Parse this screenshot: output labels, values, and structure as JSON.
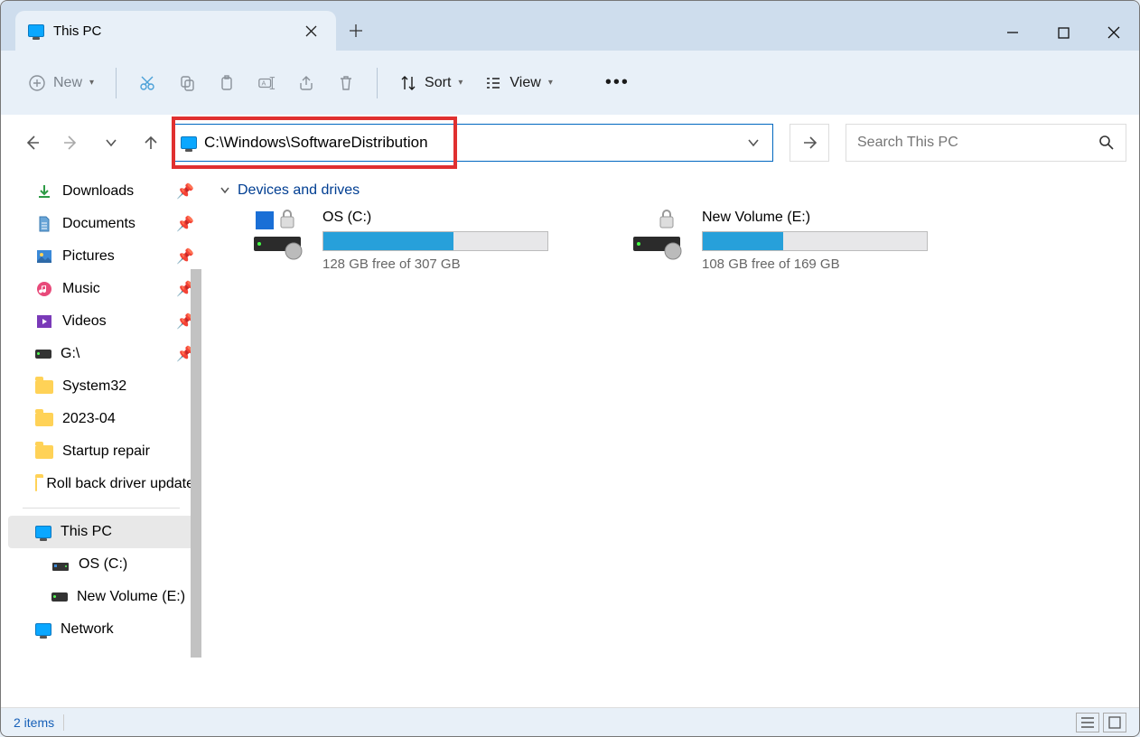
{
  "tab": {
    "title": "This PC"
  },
  "toolbar": {
    "new_label": "New",
    "sort_label": "Sort",
    "view_label": "View"
  },
  "nav": {
    "path": "C:\\Windows\\SoftwareDistribution",
    "search_placeholder": "Search This PC"
  },
  "sidebar": {
    "quick": [
      {
        "label": "Downloads",
        "icon": "download"
      },
      {
        "label": "Documents",
        "icon": "doc"
      },
      {
        "label": "Pictures",
        "icon": "pic"
      },
      {
        "label": "Music",
        "icon": "music"
      },
      {
        "label": "Videos",
        "icon": "video"
      },
      {
        "label": "G:\\",
        "icon": "drive"
      }
    ],
    "folders": [
      {
        "label": "System32"
      },
      {
        "label": "2023-04"
      },
      {
        "label": "Startup repair"
      },
      {
        "label": "Roll back driver update"
      }
    ],
    "computer": {
      "label": "This PC",
      "children": [
        {
          "label": "OS (C:)"
        },
        {
          "label": "New Volume (E:)"
        }
      ]
    },
    "network_label": "Network"
  },
  "content": {
    "section_label": "Devices and drives",
    "drives": [
      {
        "label": "OS (C:)",
        "free_text": "128 GB free of 307 GB",
        "fill_pct": 58,
        "has_lock": true,
        "system": true
      },
      {
        "label": "New Volume (E:)",
        "free_text": "108 GB free of 169 GB",
        "fill_pct": 36,
        "has_lock": true,
        "system": false
      }
    ]
  },
  "status": {
    "items_text": "2 items"
  }
}
